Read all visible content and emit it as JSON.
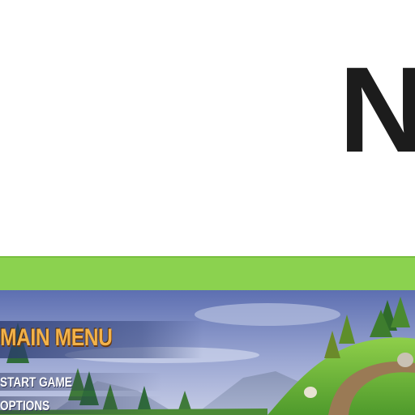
{
  "header": {
    "logo_text": "N"
  },
  "colors": {
    "green_band": "#8bd24f",
    "menu_title": "#f2b24a",
    "logo": "#1c1c1c"
  },
  "game_menu": {
    "title": "MAIN MENU",
    "items": [
      {
        "label": "START GAME"
      },
      {
        "label": "OPTIONS"
      }
    ]
  }
}
